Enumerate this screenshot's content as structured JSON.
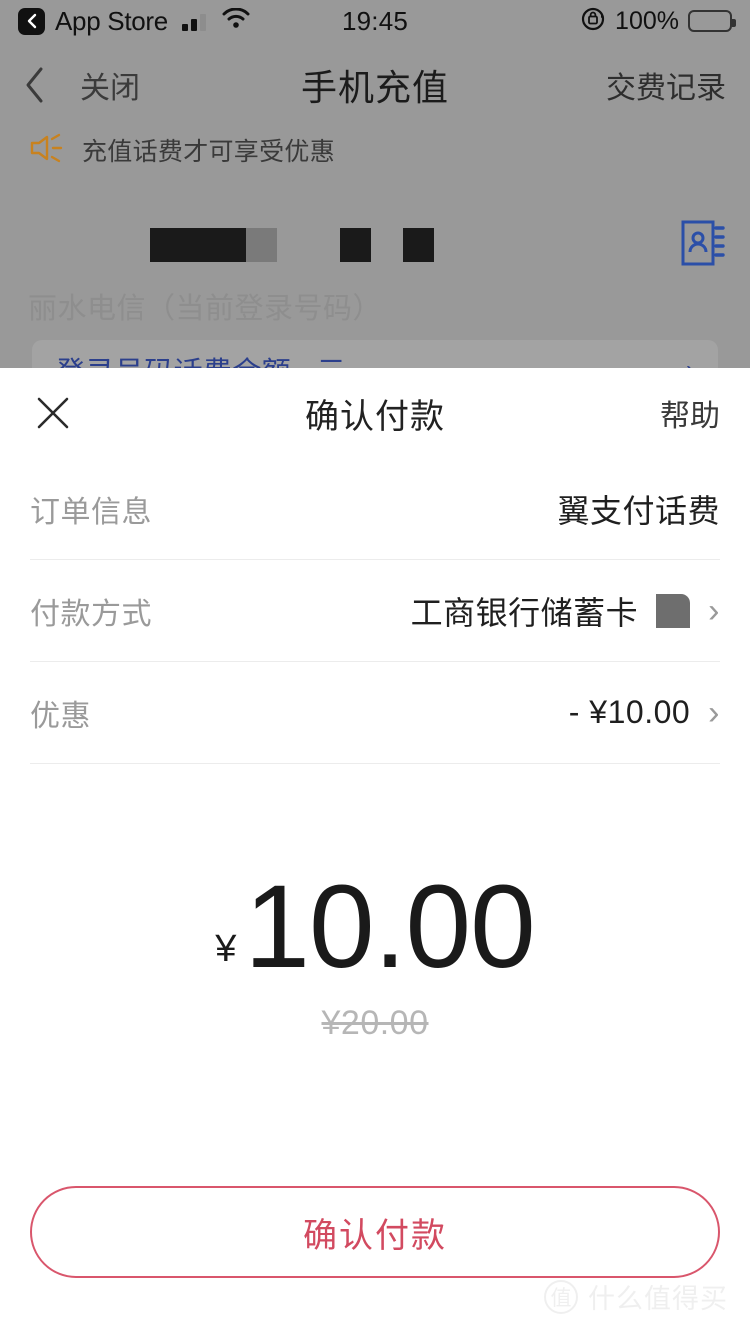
{
  "status_bar": {
    "back_app_label": "App Store",
    "back_icon": "chevron-left-icon",
    "signal_icon": "cellular-signal-icon",
    "wifi_icon": "wifi-icon",
    "time": "19:45",
    "rotation_lock_icon": "rotation-lock-icon",
    "battery_percent": "100%",
    "battery_icon": "battery-full-icon"
  },
  "nav_bar": {
    "back_icon": "chevron-left-icon",
    "close_label": "关闭",
    "title": "手机充值",
    "records_label": "交费记录"
  },
  "notice": {
    "icon": "megaphone-icon",
    "icon_color": "#c8821f",
    "text": "充值话费才可享受优惠"
  },
  "background_app": {
    "phone_number_masked": "▇▇ ▇ ▇",
    "contacts_icon": "contacts-book-icon",
    "contacts_icon_color": "#2b4fa8",
    "carrier_line": "丽水电信（当前登录号码）",
    "balance_card_text": "登录号码话费余额 ..元",
    "balance_card_chevron": "chevron-right-icon",
    "balance_text_color": "#2b3f8c"
  },
  "sheet": {
    "close_icon": "close-x-icon",
    "title": "确认付款",
    "help_label": "帮助",
    "rows": [
      {
        "label": "订单信息",
        "value": "翼支付话费",
        "has_redaction": false,
        "has_chevron": false
      },
      {
        "label": "付款方式",
        "value": "工商银行储蓄卡",
        "has_redaction": true,
        "has_chevron": true,
        "chevron_icon": "chevron-right-icon"
      },
      {
        "label": "优惠",
        "value": "- ¥10.00",
        "has_redaction": false,
        "has_chevron": true,
        "chevron_icon": "chevron-right-icon"
      }
    ],
    "price": {
      "currency_symbol": "¥",
      "amount": "10.00",
      "original_price": "¥20.00"
    },
    "confirm_button": {
      "label": "确认付款",
      "border_color": "#d9566c",
      "text_color": "#d24a60"
    }
  },
  "watermark": {
    "badge": "值",
    "text": "什么值得买"
  }
}
